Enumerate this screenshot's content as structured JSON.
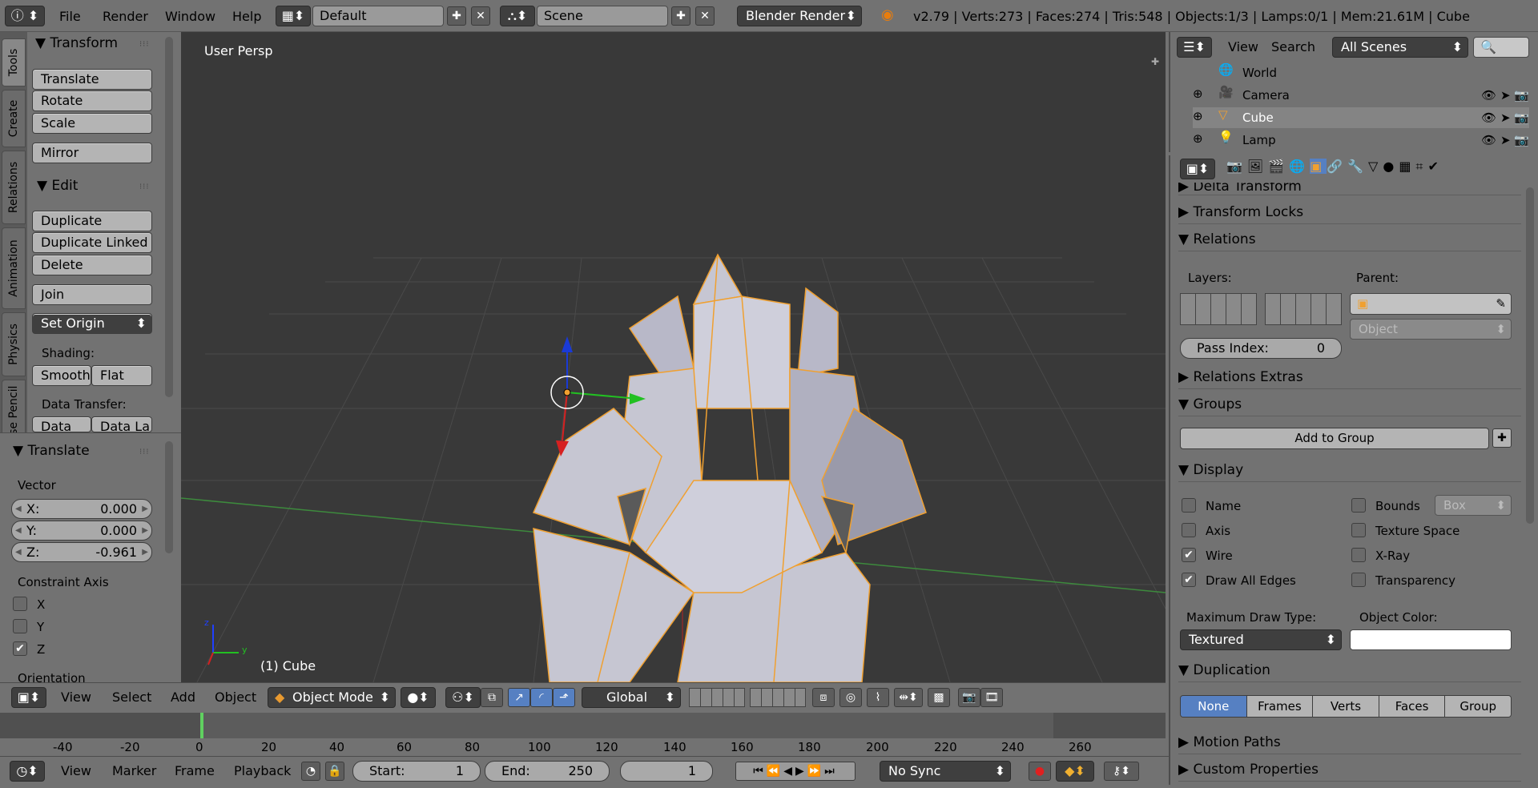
{
  "topbar": {
    "menus": [
      "File",
      "Render",
      "Window",
      "Help"
    ],
    "layout": "Default",
    "scene": "Scene",
    "engine": "Blender Render",
    "stats": "v2.79 | Verts:273 | Faces:274 | Tris:548 | Objects:1/3 | Lamps:0/1 | Mem:21.61M | Cube"
  },
  "tool_tabs": [
    "Tools",
    "Create",
    "Relations",
    "Animation",
    "Physics",
    "Grease Pencil"
  ],
  "tools": {
    "transform_header": "Transform",
    "translate": "Translate",
    "rotate": "Rotate",
    "scale": "Scale",
    "mirror": "Mirror",
    "edit_header": "Edit",
    "duplicate": "Duplicate",
    "duplicate_linked": "Duplicate Linked",
    "delete": "Delete",
    "join": "Join",
    "set_origin": "Set Origin",
    "shading_label": "Shading:",
    "smooth": "Smooth",
    "flat": "Flat",
    "data_transfer_label": "Data Transfer:",
    "data": "Data",
    "data_la": "Data La"
  },
  "operator": {
    "header": "Translate",
    "vector_label": "Vector",
    "x_label": "X:",
    "x_value": "0.000",
    "y_label": "Y:",
    "y_value": "0.000",
    "z_label": "Z:",
    "z_value": "-0.961",
    "constraint_label": "Constraint Axis",
    "cx": "X",
    "cy": "Y",
    "cz": "Z",
    "cx_checked": false,
    "cy_checked": false,
    "cz_checked": true,
    "orientation_label": "Orientation"
  },
  "viewport": {
    "view_label": "User Persp",
    "object_label": "(1) Cube",
    "axis_z": "z",
    "axis_y": "y"
  },
  "viewport_header": {
    "menus": [
      "View",
      "Select",
      "Add",
      "Object"
    ],
    "mode": "Object Mode",
    "orientation": "Global"
  },
  "timeline": {
    "ticks": [
      "-40",
      "-20",
      "0",
      "20",
      "40",
      "60",
      "80",
      "100",
      "120",
      "140",
      "160",
      "180",
      "200",
      "220",
      "240",
      "260"
    ],
    "menus": [
      "View",
      "Marker",
      "Frame",
      "Playback"
    ],
    "start_label": "Start:",
    "start_value": "1",
    "end_label": "End:",
    "end_value": "250",
    "current_frame": "1",
    "sync": "No Sync"
  },
  "outliner": {
    "menus": [
      "View",
      "Search"
    ],
    "filter": "All Scenes",
    "items": [
      "World",
      "Camera",
      "Cube",
      "Lamp"
    ]
  },
  "properties": {
    "delta_transform": "Delta Transform",
    "transform_locks": "Transform Locks",
    "relations": "Relations",
    "layers_label": "Layers:",
    "parent_label": "Parent:",
    "parent_type": "Object",
    "pass_index_label": "Pass Index:",
    "pass_index_value": "0",
    "relations_extras": "Relations Extras",
    "groups": "Groups",
    "add_to_group": "Add to Group",
    "display": "Display",
    "name": "Name",
    "axis": "Axis",
    "wire": "Wire",
    "draw_all_edges": "Draw All Edges",
    "bounds": "Bounds",
    "bounds_type": "Box",
    "texture_space": "Texture Space",
    "xray": "X-Ray",
    "transparency": "Transparency",
    "max_draw_label": "Maximum Draw Type:",
    "max_draw_value": "Textured",
    "object_color_label": "Object Color:",
    "duplication": "Duplication",
    "dup_options": [
      "None",
      "Frames",
      "Verts",
      "Faces",
      "Group"
    ],
    "motion_paths": "Motion Paths",
    "custom_properties": "Custom Properties"
  },
  "colors": {
    "selection": "#f0a030",
    "active_tab": "#5680c2",
    "mesh": "#c6c6d2"
  }
}
